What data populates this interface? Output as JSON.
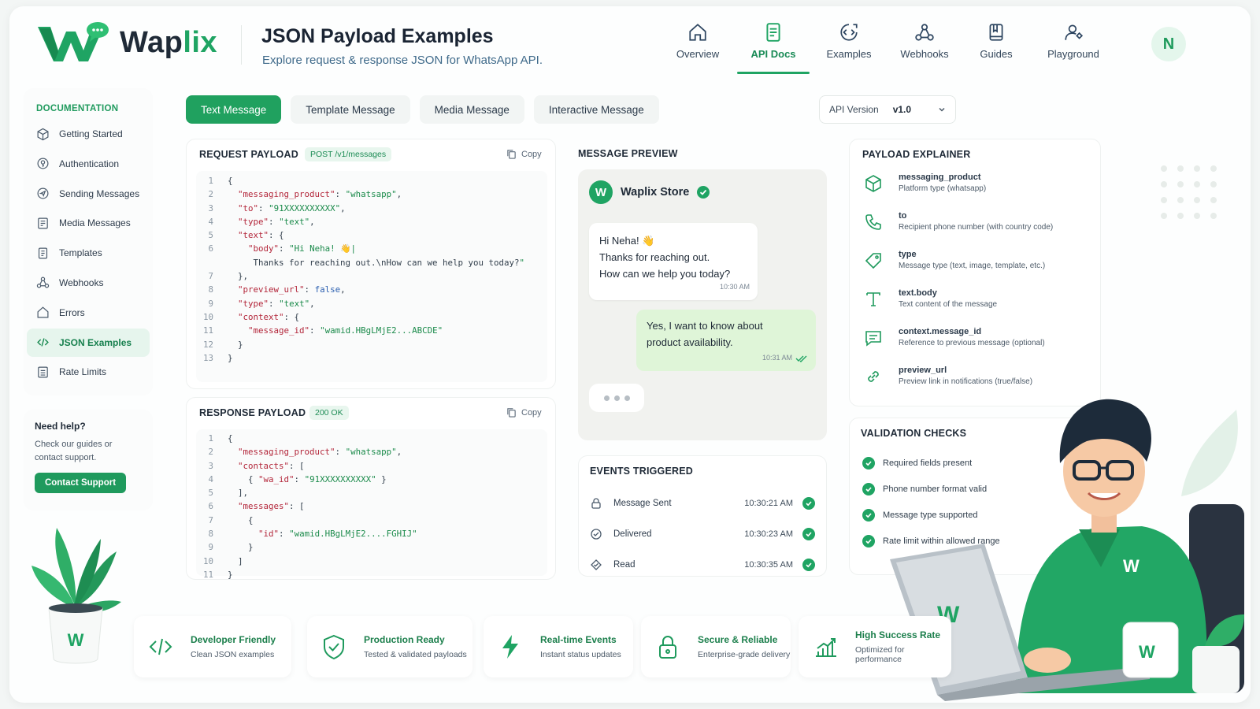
{
  "brand": {
    "name_part1": "Wap",
    "name_part2": "lix",
    "color": "#1fa463"
  },
  "header": {
    "title": "JSON Payload Examples",
    "subtitle": "Explore request & response JSON for WhatsApp API.",
    "nav": [
      {
        "label": "Overview",
        "icon": "home-icon"
      },
      {
        "label": "API Docs",
        "icon": "document-icon",
        "active": true
      },
      {
        "label": "Examples",
        "icon": "examples-icon"
      },
      {
        "label": "Webhooks",
        "icon": "webhook-icon"
      },
      {
        "label": "Guides",
        "icon": "book-icon"
      },
      {
        "label": "Playground",
        "icon": "playground-icon"
      }
    ],
    "avatar_initial": "N"
  },
  "sidebar": {
    "heading": "DOCUMENTATION",
    "items": [
      {
        "label": "Getting Started",
        "icon": "cube-icon"
      },
      {
        "label": "Authentication",
        "icon": "key-icon"
      },
      {
        "label": "Sending Messages",
        "icon": "send-icon"
      },
      {
        "label": "Media Messages",
        "icon": "image-icon"
      },
      {
        "label": "Templates",
        "icon": "template-icon"
      },
      {
        "label": "Webhooks",
        "icon": "webhook-icon"
      },
      {
        "label": "Errors",
        "icon": "home-icon"
      },
      {
        "label": "JSON Examples",
        "icon": "code-icon",
        "active": true
      },
      {
        "label": "Rate Limits",
        "icon": "list-icon"
      }
    ],
    "help": {
      "title": "Need help?",
      "text": "Check our guides or contact support.",
      "button": "Contact Support"
    }
  },
  "tabs": [
    {
      "label": "Text Message",
      "active": true
    },
    {
      "label": "Template Message"
    },
    {
      "label": "Media Message"
    },
    {
      "label": "Interactive Message"
    }
  ],
  "api_version": {
    "label": "API Version",
    "value": "v1.0"
  },
  "request": {
    "title": "REQUEST PAYLOAD",
    "badge": "POST /v1/messages",
    "copy_label": "Copy",
    "lines": [
      {
        "n": "1",
        "t": "{"
      },
      {
        "n": "2",
        "t": "  \"messaging_product\": \"whatsapp\","
      },
      {
        "n": "3",
        "t": "  \"to\": \"91XXXXXXXXXX\","
      },
      {
        "n": "4",
        "t": "  \"type\": \"text\","
      },
      {
        "n": "5",
        "t": "  \"text\": {"
      },
      {
        "n": "6",
        "t": "    \"body\": \"Hi Neha! 👋|"
      },
      {
        "n": "",
        "t": "     Thanks for reaching out.\\nHow can we help you today?\""
      },
      {
        "n": "7",
        "t": "  },"
      },
      {
        "n": "8",
        "t": "  \"preview_url\": false,"
      },
      {
        "n": "9",
        "t": "  \"type\": \"text\","
      },
      {
        "n": "10",
        "t": "  \"context\": {"
      },
      {
        "n": "11",
        "t": "    \"message_id\": \"wamid.HBgLMjE2...ABCDE\""
      },
      {
        "n": "12",
        "t": "  }"
      },
      {
        "n": "13",
        "t": "}"
      }
    ]
  },
  "response": {
    "title": "RESPONSE PAYLOAD",
    "badge": "200 OK",
    "copy_label": "Copy",
    "lines": [
      {
        "n": "1",
        "t": "{"
      },
      {
        "n": "2",
        "t": "  \"messaging_product\": \"whatsapp\","
      },
      {
        "n": "3",
        "t": "  \"contacts\": ["
      },
      {
        "n": "4",
        "t": "    { \"wa_id\": \"91XXXXXXXXXX\" }"
      },
      {
        "n": "5",
        "t": "  ],"
      },
      {
        "n": "6",
        "t": "  \"messages\": ["
      },
      {
        "n": "7",
        "t": "    {"
      },
      {
        "n": "8",
        "t": "      \"id\": \"wamid.HBgLMjE2....FGHIJ\""
      },
      {
        "n": "9",
        "t": "    }"
      },
      {
        "n": "10",
        "t": "  ]"
      },
      {
        "n": "11",
        "t": "}"
      }
    ]
  },
  "preview": {
    "title": "MESSAGE PREVIEW",
    "store_name": "Waplix Store",
    "incoming": {
      "line1": "Hi Neha! 👋",
      "line2": "Thanks for reaching out.",
      "line3": "How can we help you today?",
      "time": "10:30 AM"
    },
    "outgoing": {
      "line1": "Yes, I want to know about",
      "line2": "product availability.",
      "time": "10:31 AM"
    }
  },
  "events": {
    "title": "EVENTS TRIGGERED",
    "items": [
      {
        "name": "Message Sent",
        "time": "10:30:21 AM"
      },
      {
        "name": "Delivered",
        "time": "10:30:23 AM"
      },
      {
        "name": "Read",
        "time": "10:30:35 AM"
      }
    ]
  },
  "explainer": {
    "title": "PAYLOAD EXPLAINER",
    "items": [
      {
        "key": "messaging_product",
        "desc": "Platform type (whatsapp)",
        "icon": "cube-icon"
      },
      {
        "key": "to",
        "desc": "Recipient phone number (with country code)",
        "icon": "phone-icon"
      },
      {
        "key": "type",
        "desc": "Message type (text, image, template, etc.)",
        "icon": "tag-icon"
      },
      {
        "key": "text.body",
        "desc": "Text content of the message",
        "icon": "text-icon"
      },
      {
        "key": "context.message_id",
        "desc": "Reference to previous message (optional)",
        "icon": "chat-icon"
      },
      {
        "key": "preview_url",
        "desc": "Preview link in notifications (true/false)",
        "icon": "link-icon"
      }
    ]
  },
  "validation": {
    "title": "VALIDATION CHECKS",
    "items": [
      "Required fields present",
      "Phone number format valid",
      "Message type supported",
      "Rate limit within allowed range"
    ]
  },
  "features": [
    {
      "title": "Developer Friendly",
      "sub": "Clean JSON examples",
      "icon": "code-icon"
    },
    {
      "title": "Production Ready",
      "sub": "Tested & validated payloads",
      "icon": "shield-icon"
    },
    {
      "title": "Real-time Events",
      "sub": "Instant status updates",
      "icon": "bolt-icon"
    },
    {
      "title": "Secure & Reliable",
      "sub": "Enterprise-grade delivery",
      "icon": "lock-icon"
    },
    {
      "title": "High Success Rate",
      "sub": "Optimized for performance",
      "icon": "chart-icon"
    }
  ]
}
